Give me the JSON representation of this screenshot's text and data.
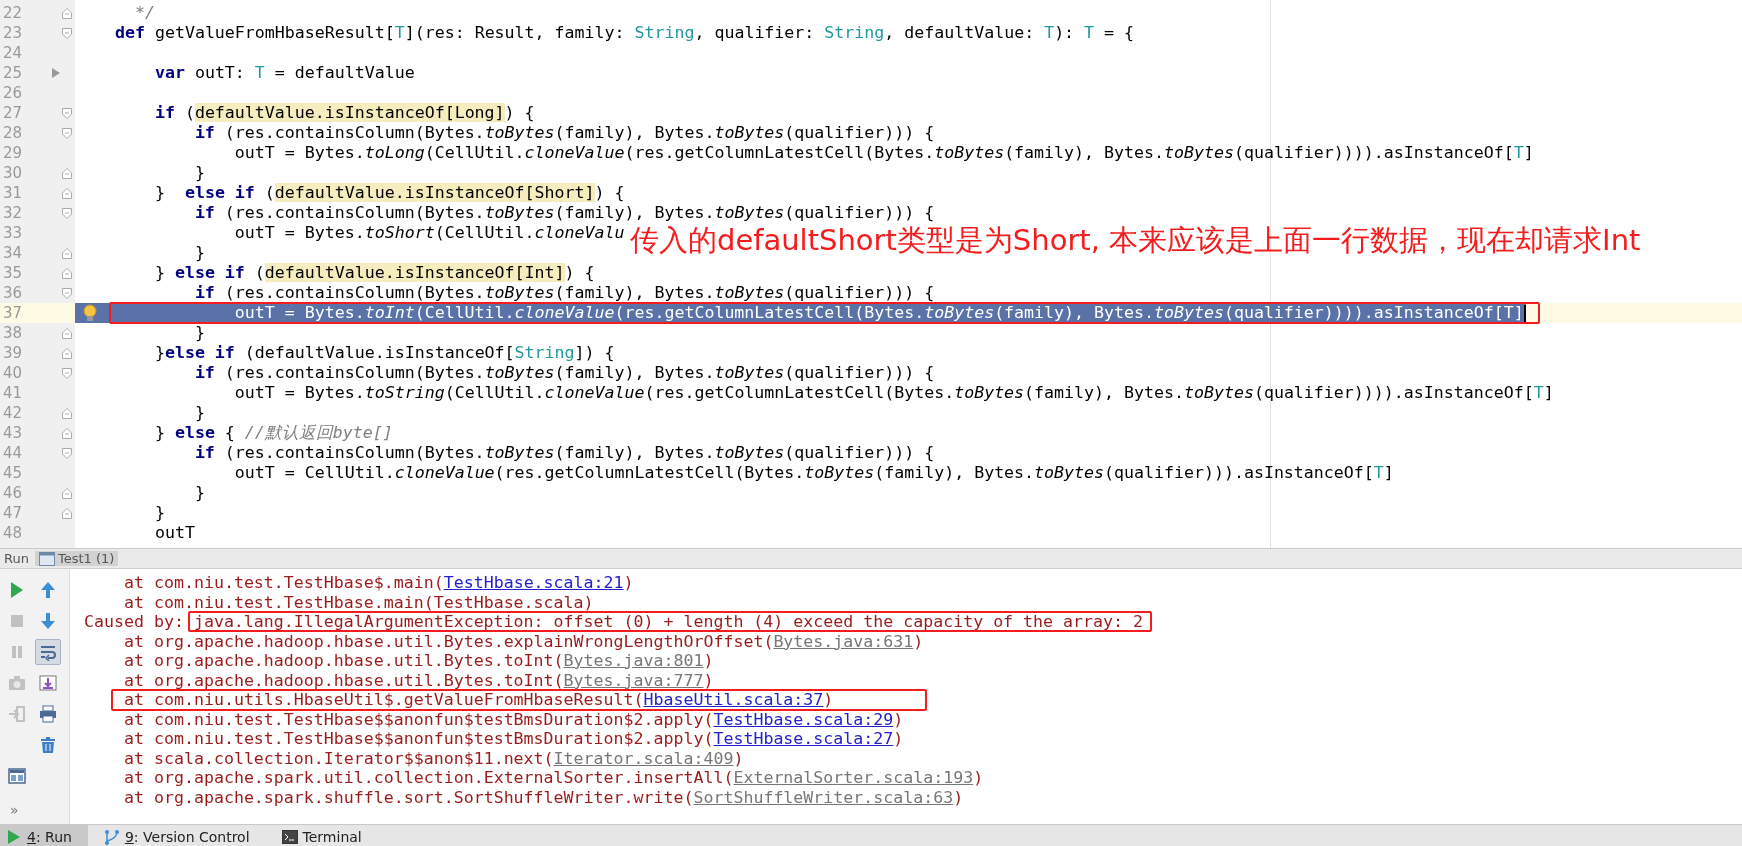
{
  "editor": {
    "lines": [
      {
        "number": "22",
        "icons": [
          {
            "kind": "fold-end"
          }
        ],
        "code": [
          {
            "kind": "comment",
            "text": "      */"
          }
        ]
      },
      {
        "number": "23",
        "icons": [
          {
            "kind": "fold-start"
          }
        ],
        "code": [
          {
            "kind": "keyword",
            "text": "    def"
          },
          " getValueFromHbaseResult[",
          {
            "kind": "type",
            "text": "T"
          },
          "](res: Result, family: ",
          {
            "kind": "type",
            "text": "String"
          },
          ", qualifier: ",
          {
            "kind": "type",
            "text": "String"
          },
          ", defaultValue: ",
          {
            "kind": "type",
            "text": "T"
          },
          "): ",
          {
            "kind": "type",
            "text": "T"
          },
          " = {"
        ]
      },
      {
        "number": "24"
      },
      {
        "number": "25",
        "icons": [
          {
            "kind": "arrow"
          }
        ],
        "code": [
          {
            "kind": "keyword",
            "text": "        var"
          },
          " outT: ",
          {
            "kind": "type",
            "text": "T"
          },
          " = defaultValue"
        ]
      },
      {
        "number": "26"
      },
      {
        "number": "27",
        "icons": [
          {
            "kind": "fold-start"
          }
        ],
        "code": [
          {
            "kind": "keyword",
            "text": "        if"
          },
          " (",
          {
            "kind": "highlight",
            "text": "defaultValue.isInstanceOf[Long]"
          },
          ") {"
        ]
      },
      {
        "number": "28",
        "icons": [
          {
            "kind": "fold-start"
          }
        ],
        "code": [
          {
            "kind": "keyword",
            "text": "            if"
          },
          " (res.containsColumn(Bytes.",
          {
            "kind": "method",
            "text": "toBytes"
          },
          "(family), Bytes.",
          {
            "kind": "method",
            "text": "toBytes"
          },
          "(qualifier))) {"
        ]
      },
      {
        "number": "29",
        "code": [
          "                outT = Bytes.",
          {
            "kind": "method",
            "text": "toLong"
          },
          "(CellUtil.",
          {
            "kind": "method",
            "text": "cloneValue"
          },
          "(res.getColumnLatestCell(Bytes.",
          {
            "kind": "method",
            "text": "toBytes"
          },
          "(family), Bytes.",
          {
            "kind": "method",
            "text": "toBytes"
          },
          "(qualifier)))).asInstanceOf[",
          {
            "kind": "type",
            "text": "T"
          },
          "]"
        ]
      },
      {
        "number": "30",
        "icons": [
          {
            "kind": "fold-end"
          }
        ],
        "code": [
          "            }"
        ]
      },
      {
        "number": "31",
        "icons": [
          {
            "kind": "fold-end"
          }
        ],
        "code": [
          "        }  ",
          {
            "kind": "keyword",
            "text": "else if"
          },
          " (",
          {
            "kind": "highlight",
            "text": "defaultValue.isInstanceOf[Short]"
          },
          ") {"
        ]
      },
      {
        "number": "32",
        "icons": [
          {
            "kind": "fold-start"
          }
        ],
        "code": [
          {
            "kind": "keyword",
            "text": "            if"
          },
          " (res.containsColumn(Bytes.",
          {
            "kind": "method",
            "text": "toBytes"
          },
          "(family), Bytes.",
          {
            "kind": "method",
            "text": "toBytes"
          },
          "(qualifier))) {"
        ]
      },
      {
        "number": "33",
        "code": [
          "                outT = Bytes.",
          {
            "kind": "method",
            "text": "toShort"
          },
          "(CellUtil.",
          {
            "kind": "method",
            "text": "cloneValu"
          }
        ]
      },
      {
        "number": "34",
        "icons": [
          {
            "kind": "fold-end"
          }
        ],
        "code": [
          "            }"
        ]
      },
      {
        "number": "35",
        "icons": [
          {
            "kind": "fold-end"
          }
        ],
        "code": [
          "        } ",
          {
            "kind": "keyword",
            "text": "else if"
          },
          " (",
          {
            "kind": "highlight",
            "text": "defaultValue.isInstanceOf[Int]"
          },
          ") {"
        ]
      },
      {
        "number": "36",
        "icons": [
          {
            "kind": "fold-start"
          }
        ],
        "code": [
          {
            "kind": "keyword",
            "text": "            if"
          },
          " (res.containsColumn(Bytes.",
          {
            "kind": "method",
            "text": "toBytes"
          },
          "(family), Bytes.",
          {
            "kind": "method",
            "text": "toBytes"
          },
          "(qualifier))) {"
        ]
      },
      {
        "number": "37",
        "selected": true,
        "boxed": true,
        "icons": [
          {
            "kind": "bulb"
          }
        ],
        "code": [
          "                outT = Bytes.",
          {
            "kind": "method",
            "text": "toInt"
          },
          "(CellUtil.",
          {
            "kind": "method",
            "text": "cloneValue"
          },
          "(res.getColumnLatestCell(Bytes.",
          {
            "kind": "method",
            "text": "toBytes"
          },
          "(family), Bytes.",
          {
            "kind": "method",
            "text": "toBytes"
          },
          "(qualifier)))).asInstanceOf[T]"
        ]
      },
      {
        "number": "38",
        "icons": [
          {
            "kind": "fold-end"
          }
        ],
        "code": [
          "            }"
        ]
      },
      {
        "number": "39",
        "icons": [
          {
            "kind": "fold-end"
          }
        ],
        "code": [
          "        }",
          {
            "kind": "keyword",
            "text": "else if"
          },
          " (defaultValue.isInstanceOf[",
          {
            "kind": "type",
            "text": "String"
          },
          "]) {"
        ]
      },
      {
        "number": "40",
        "icons": [
          {
            "kind": "fold-start"
          }
        ],
        "code": [
          {
            "kind": "keyword",
            "text": "            if"
          },
          " (res.containsColumn(Bytes.",
          {
            "kind": "method",
            "text": "toBytes"
          },
          "(family), Bytes.",
          {
            "kind": "method",
            "text": "toBytes"
          },
          "(qualifier))) {"
        ]
      },
      {
        "number": "41",
        "code": [
          "                outT = Bytes.",
          {
            "kind": "method",
            "text": "toString"
          },
          "(CellUtil.",
          {
            "kind": "method",
            "text": "cloneValue"
          },
          "(res.getColumnLatestCell(Bytes.",
          {
            "kind": "method",
            "text": "toBytes"
          },
          "(family), Bytes.",
          {
            "kind": "method",
            "text": "toBytes"
          },
          "(qualifier)))).asInstanceOf[",
          {
            "kind": "type",
            "text": "T"
          },
          "]"
        ]
      },
      {
        "number": "42",
        "icons": [
          {
            "kind": "fold-end"
          }
        ],
        "code": [
          "            }"
        ]
      },
      {
        "number": "43",
        "icons": [
          {
            "kind": "fold-end"
          }
        ],
        "code": [
          "        } ",
          {
            "kind": "keyword",
            "text": "else"
          },
          " { ",
          {
            "kind": "comment",
            "text": "//默认返回byte[]"
          }
        ]
      },
      {
        "number": "44",
        "icons": [
          {
            "kind": "fold-start"
          }
        ],
        "code": [
          {
            "kind": "keyword",
            "text": "            if"
          },
          " (res.containsColumn(Bytes.",
          {
            "kind": "method",
            "text": "toBytes"
          },
          "(family), Bytes.",
          {
            "kind": "method",
            "text": "toBytes"
          },
          "(qualifier))) {"
        ]
      },
      {
        "number": "45",
        "code": [
          "                outT = CellUtil.",
          {
            "kind": "method",
            "text": "cloneValue"
          },
          "(res.getColumnLatestCell(Bytes.",
          {
            "kind": "method",
            "text": "toBytes"
          },
          "(family), Bytes.",
          {
            "kind": "method",
            "text": "toBytes"
          },
          "(qualifier))).asInstanceOf[",
          {
            "kind": "type",
            "text": "T"
          },
          "]"
        ]
      },
      {
        "number": "46",
        "icons": [
          {
            "kind": "fold-end"
          }
        ],
        "code": [
          "            }"
        ]
      },
      {
        "number": "47",
        "icons": [
          {
            "kind": "fold-end"
          }
        ],
        "code": [
          "        }"
        ]
      },
      {
        "number": "48",
        "code": [
          "        outT"
        ]
      }
    ],
    "annotation": "传入的defaultShort类型是为Short, 本来应该是上面一行数据，现在却请求Int"
  },
  "run_panel": {
    "title": "Run",
    "tabs": [
      {
        "label": "Test1 (1)",
        "selected": true
      }
    ],
    "toolbar": [
      {
        "kind": "run",
        "disabled": false,
        "on": false
      },
      {
        "kind": "up",
        "disabled": false,
        "on": false
      },
      {
        "kind": "stop",
        "disabled": true,
        "on": false
      },
      {
        "kind": "down",
        "disabled": false,
        "on": false
      },
      {
        "kind": "pause",
        "disabled": true,
        "on": false
      },
      {
        "kind": "wrap",
        "disabled": false,
        "on": true
      },
      {
        "kind": "camera",
        "disabled": true,
        "on": false
      },
      {
        "kind": "scroll-end",
        "disabled": false,
        "on": false
      },
      {
        "kind": "exit",
        "disabled": true,
        "on": false
      },
      {
        "kind": "print",
        "disabled": false,
        "on": false
      },
      {
        "kind": "spacer"
      },
      {
        "kind": "trash",
        "disabled": false,
        "on": false
      },
      {
        "kind": "layout",
        "disabled": false,
        "on": false
      }
    ],
    "more": "»",
    "console": [
      {
        "kind": "frame",
        "text": "at com.niu.test.TestHbase$.main(",
        "link": {
          "text": "TestHbase.scala:21",
          "kind": "project"
        },
        "tail": ")"
      },
      {
        "kind": "frame",
        "text": "at com.niu.test.TestHbase.main(TestHbase.scala)"
      },
      {
        "kind": "cause",
        "label": "Caused by: ",
        "text": "java.lang.IllegalArgumentException: offset (0) + length (4) exceed the capacity of the array: 2",
        "boxed": true
      },
      {
        "kind": "frame",
        "text": "at org.apache.hadoop.hbase.util.Bytes.explainWrongLengthOrOffset(",
        "link": {
          "text": "Bytes.java:631",
          "kind": "library"
        },
        "tail": ")"
      },
      {
        "kind": "frame",
        "text": "at org.apache.hadoop.hbase.util.Bytes.toInt(",
        "link": {
          "text": "Bytes.java:801",
          "kind": "library"
        },
        "tail": ")"
      },
      {
        "kind": "frame",
        "text": "at org.apache.hadoop.hbase.util.Bytes.toInt(",
        "link": {
          "text": "Bytes.java:777",
          "kind": "library"
        },
        "tail": ")"
      },
      {
        "kind": "frame",
        "text": "at com.niu.utils.HbaseUtil$.getValueFromHbaseResult(",
        "link": {
          "text": "HbaseUtil.scala:37",
          "kind": "project"
        },
        "tail": ")",
        "boxed": true
      },
      {
        "kind": "frame",
        "text": "at com.niu.test.TestHbase$$anonfun$testBmsDuration$2.apply(",
        "link": {
          "text": "TestHbase.scala:29",
          "kind": "project"
        },
        "tail": ")"
      },
      {
        "kind": "frame",
        "text": "at com.niu.test.TestHbase$$anonfun$testBmsDuration$2.apply(",
        "link": {
          "text": "TestHbase.scala:27",
          "kind": "project"
        },
        "tail": ")"
      },
      {
        "kind": "frame",
        "text": "at scala.collection.Iterator$$anon$11.next(",
        "link": {
          "text": "Iterator.scala:409",
          "kind": "library"
        },
        "tail": ")"
      },
      {
        "kind": "frame",
        "text": "at org.apache.spark.util.collection.ExternalSorter.insertAll(",
        "link": {
          "text": "ExternalSorter.scala:193",
          "kind": "library"
        },
        "tail": ")"
      },
      {
        "kind": "frame",
        "text": "at org.apache.spark.shuffle.sort.SortShuffleWriter.write(",
        "link": {
          "text": "SortShuffleWriter.scala:63",
          "kind": "library"
        },
        "tail": ")"
      }
    ]
  },
  "tool_windows": [
    {
      "kind": "run",
      "label": "4: Run",
      "mnemonic": true,
      "selected": true
    },
    {
      "kind": "vcs",
      "label": "9: Version Control",
      "mnemonic": true,
      "selected": false
    },
    {
      "kind": "terminal",
      "label": "Terminal",
      "mnemonic": false,
      "selected": false
    }
  ]
}
